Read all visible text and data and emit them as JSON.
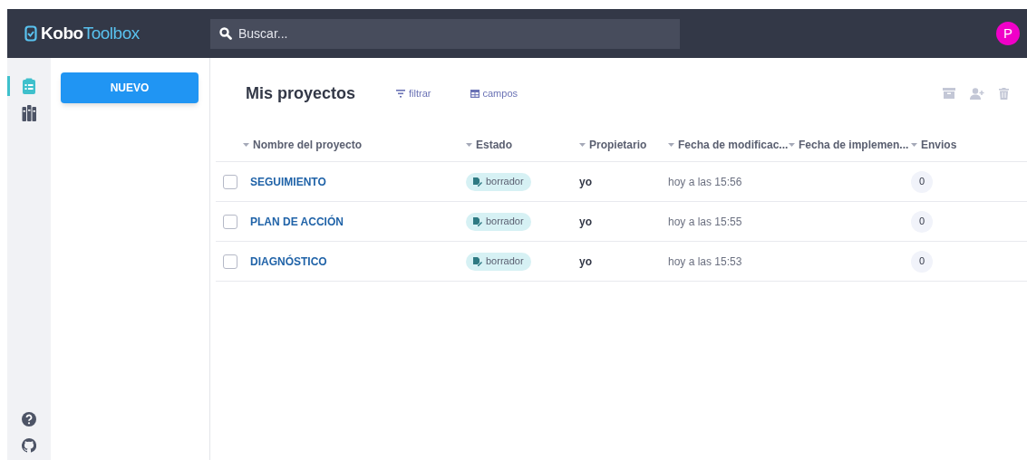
{
  "header": {
    "logo": "**Kobo**Toolbox",
    "search": {
      "placeholder": "Buscar..."
    },
    "avatar": "P"
  },
  "nav": [
    {
      "kind": "projects",
      "selected": true
    },
    {
      "kind": "library",
      "selected": false
    }
  ],
  "nav_bottom": [
    {
      "kind": "help"
    },
    {
      "kind": "github"
    }
  ],
  "new_button": "NUEVO",
  "title": "Mis proyectos",
  "toolbar": [
    {
      "kind": "filter",
      "label": "filtrar"
    },
    {
      "kind": "fields",
      "label": "campos"
    }
  ],
  "actions": [
    {
      "kind": "archive",
      "disabled": true
    },
    {
      "kind": "share",
      "disabled": true
    },
    {
      "kind": "delete",
      "disabled": true
    }
  ],
  "table": {
    "columns": [
      "Nombre del proyecto",
      "Estado",
      "Propietario",
      "Fecha de modificac...",
      "Fecha de implemen...",
      "Envios"
    ],
    "rows": [
      {
        "checked": false,
        "name": "SEGUIMIENTO",
        "status": "borrador",
        "owner": "yo",
        "modified": "hoy a las 15:56",
        "submissions": "0"
      },
      {
        "checked": false,
        "name": "PLAN DE ACCIÓN",
        "status": "borrador",
        "owner": "yo",
        "modified": "hoy a las 15:55",
        "submissions": "0"
      },
      {
        "checked": false,
        "name": "DIAGNÓSTICO",
        "status": "borrador",
        "owner": "yo",
        "modified": "hoy a las 15:53",
        "submissions": "0"
      }
    ]
  }
}
